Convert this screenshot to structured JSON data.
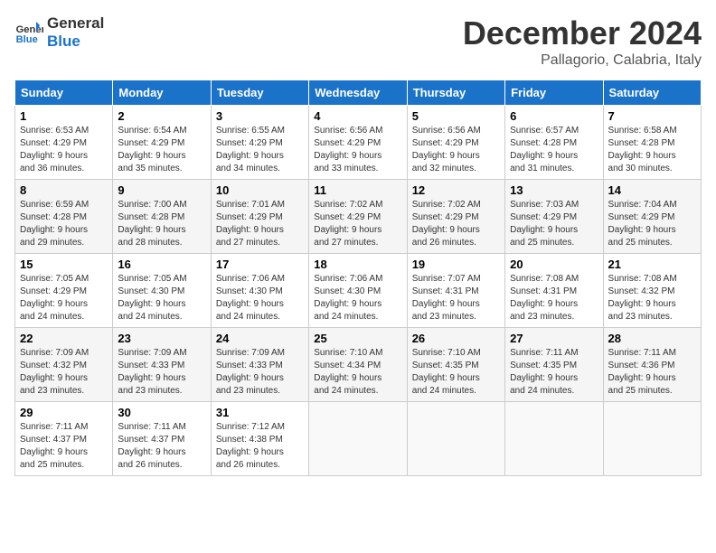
{
  "header": {
    "logo_line1": "General",
    "logo_line2": "Blue",
    "month": "December 2024",
    "location": "Pallagorio, Calabria, Italy"
  },
  "weekdays": [
    "Sunday",
    "Monday",
    "Tuesday",
    "Wednesday",
    "Thursday",
    "Friday",
    "Saturday"
  ],
  "weeks": [
    [
      {
        "day": "1",
        "info": "Sunrise: 6:53 AM\nSunset: 4:29 PM\nDaylight: 9 hours\nand 36 minutes."
      },
      {
        "day": "2",
        "info": "Sunrise: 6:54 AM\nSunset: 4:29 PM\nDaylight: 9 hours\nand 35 minutes."
      },
      {
        "day": "3",
        "info": "Sunrise: 6:55 AM\nSunset: 4:29 PM\nDaylight: 9 hours\nand 34 minutes."
      },
      {
        "day": "4",
        "info": "Sunrise: 6:56 AM\nSunset: 4:29 PM\nDaylight: 9 hours\nand 33 minutes."
      },
      {
        "day": "5",
        "info": "Sunrise: 6:56 AM\nSunset: 4:29 PM\nDaylight: 9 hours\nand 32 minutes."
      },
      {
        "day": "6",
        "info": "Sunrise: 6:57 AM\nSunset: 4:28 PM\nDaylight: 9 hours\nand 31 minutes."
      },
      {
        "day": "7",
        "info": "Sunrise: 6:58 AM\nSunset: 4:28 PM\nDaylight: 9 hours\nand 30 minutes."
      }
    ],
    [
      {
        "day": "8",
        "info": "Sunrise: 6:59 AM\nSunset: 4:28 PM\nDaylight: 9 hours\nand 29 minutes."
      },
      {
        "day": "9",
        "info": "Sunrise: 7:00 AM\nSunset: 4:28 PM\nDaylight: 9 hours\nand 28 minutes."
      },
      {
        "day": "10",
        "info": "Sunrise: 7:01 AM\nSunset: 4:29 PM\nDaylight: 9 hours\nand 27 minutes."
      },
      {
        "day": "11",
        "info": "Sunrise: 7:02 AM\nSunset: 4:29 PM\nDaylight: 9 hours\nand 27 minutes."
      },
      {
        "day": "12",
        "info": "Sunrise: 7:02 AM\nSunset: 4:29 PM\nDaylight: 9 hours\nand 26 minutes."
      },
      {
        "day": "13",
        "info": "Sunrise: 7:03 AM\nSunset: 4:29 PM\nDaylight: 9 hours\nand 25 minutes."
      },
      {
        "day": "14",
        "info": "Sunrise: 7:04 AM\nSunset: 4:29 PM\nDaylight: 9 hours\nand 25 minutes."
      }
    ],
    [
      {
        "day": "15",
        "info": "Sunrise: 7:05 AM\nSunset: 4:29 PM\nDaylight: 9 hours\nand 24 minutes."
      },
      {
        "day": "16",
        "info": "Sunrise: 7:05 AM\nSunset: 4:30 PM\nDaylight: 9 hours\nand 24 minutes."
      },
      {
        "day": "17",
        "info": "Sunrise: 7:06 AM\nSunset: 4:30 PM\nDaylight: 9 hours\nand 24 minutes."
      },
      {
        "day": "18",
        "info": "Sunrise: 7:06 AM\nSunset: 4:30 PM\nDaylight: 9 hours\nand 24 minutes."
      },
      {
        "day": "19",
        "info": "Sunrise: 7:07 AM\nSunset: 4:31 PM\nDaylight: 9 hours\nand 23 minutes."
      },
      {
        "day": "20",
        "info": "Sunrise: 7:08 AM\nSunset: 4:31 PM\nDaylight: 9 hours\nand 23 minutes."
      },
      {
        "day": "21",
        "info": "Sunrise: 7:08 AM\nSunset: 4:32 PM\nDaylight: 9 hours\nand 23 minutes."
      }
    ],
    [
      {
        "day": "22",
        "info": "Sunrise: 7:09 AM\nSunset: 4:32 PM\nDaylight: 9 hours\nand 23 minutes."
      },
      {
        "day": "23",
        "info": "Sunrise: 7:09 AM\nSunset: 4:33 PM\nDaylight: 9 hours\nand 23 minutes."
      },
      {
        "day": "24",
        "info": "Sunrise: 7:09 AM\nSunset: 4:33 PM\nDaylight: 9 hours\nand 23 minutes."
      },
      {
        "day": "25",
        "info": "Sunrise: 7:10 AM\nSunset: 4:34 PM\nDaylight: 9 hours\nand 24 minutes."
      },
      {
        "day": "26",
        "info": "Sunrise: 7:10 AM\nSunset: 4:35 PM\nDaylight: 9 hours\nand 24 minutes."
      },
      {
        "day": "27",
        "info": "Sunrise: 7:11 AM\nSunset: 4:35 PM\nDaylight: 9 hours\nand 24 minutes."
      },
      {
        "day": "28",
        "info": "Sunrise: 7:11 AM\nSunset: 4:36 PM\nDaylight: 9 hours\nand 25 minutes."
      }
    ],
    [
      {
        "day": "29",
        "info": "Sunrise: 7:11 AM\nSunset: 4:37 PM\nDaylight: 9 hours\nand 25 minutes."
      },
      {
        "day": "30",
        "info": "Sunrise: 7:11 AM\nSunset: 4:37 PM\nDaylight: 9 hours\nand 26 minutes."
      },
      {
        "day": "31",
        "info": "Sunrise: 7:12 AM\nSunset: 4:38 PM\nDaylight: 9 hours\nand 26 minutes."
      },
      null,
      null,
      null,
      null
    ]
  ]
}
